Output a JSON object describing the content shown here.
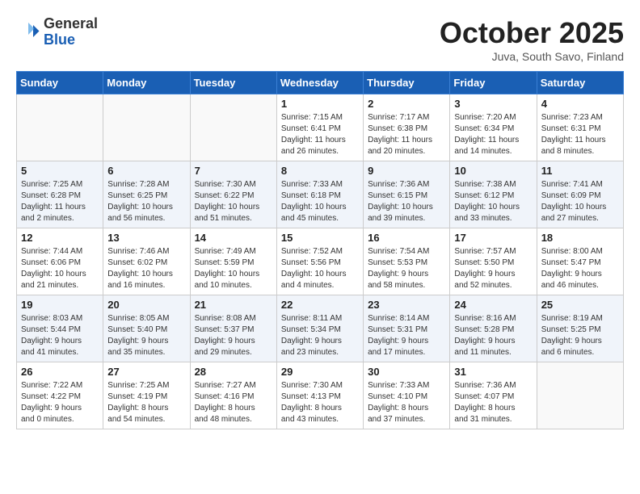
{
  "header": {
    "logo_general": "General",
    "logo_blue": "Blue",
    "month": "October 2025",
    "location": "Juva, South Savo, Finland"
  },
  "weekdays": [
    "Sunday",
    "Monday",
    "Tuesday",
    "Wednesday",
    "Thursday",
    "Friday",
    "Saturday"
  ],
  "weeks": [
    [
      {
        "day": "",
        "info": ""
      },
      {
        "day": "",
        "info": ""
      },
      {
        "day": "",
        "info": ""
      },
      {
        "day": "1",
        "info": "Sunrise: 7:15 AM\nSunset: 6:41 PM\nDaylight: 11 hours\nand 26 minutes."
      },
      {
        "day": "2",
        "info": "Sunrise: 7:17 AM\nSunset: 6:38 PM\nDaylight: 11 hours\nand 20 minutes."
      },
      {
        "day": "3",
        "info": "Sunrise: 7:20 AM\nSunset: 6:34 PM\nDaylight: 11 hours\nand 14 minutes."
      },
      {
        "day": "4",
        "info": "Sunrise: 7:23 AM\nSunset: 6:31 PM\nDaylight: 11 hours\nand 8 minutes."
      }
    ],
    [
      {
        "day": "5",
        "info": "Sunrise: 7:25 AM\nSunset: 6:28 PM\nDaylight: 11 hours\nand 2 minutes."
      },
      {
        "day": "6",
        "info": "Sunrise: 7:28 AM\nSunset: 6:25 PM\nDaylight: 10 hours\nand 56 minutes."
      },
      {
        "day": "7",
        "info": "Sunrise: 7:30 AM\nSunset: 6:22 PM\nDaylight: 10 hours\nand 51 minutes."
      },
      {
        "day": "8",
        "info": "Sunrise: 7:33 AM\nSunset: 6:18 PM\nDaylight: 10 hours\nand 45 minutes."
      },
      {
        "day": "9",
        "info": "Sunrise: 7:36 AM\nSunset: 6:15 PM\nDaylight: 10 hours\nand 39 minutes."
      },
      {
        "day": "10",
        "info": "Sunrise: 7:38 AM\nSunset: 6:12 PM\nDaylight: 10 hours\nand 33 minutes."
      },
      {
        "day": "11",
        "info": "Sunrise: 7:41 AM\nSunset: 6:09 PM\nDaylight: 10 hours\nand 27 minutes."
      }
    ],
    [
      {
        "day": "12",
        "info": "Sunrise: 7:44 AM\nSunset: 6:06 PM\nDaylight: 10 hours\nand 21 minutes."
      },
      {
        "day": "13",
        "info": "Sunrise: 7:46 AM\nSunset: 6:02 PM\nDaylight: 10 hours\nand 16 minutes."
      },
      {
        "day": "14",
        "info": "Sunrise: 7:49 AM\nSunset: 5:59 PM\nDaylight: 10 hours\nand 10 minutes."
      },
      {
        "day": "15",
        "info": "Sunrise: 7:52 AM\nSunset: 5:56 PM\nDaylight: 10 hours\nand 4 minutes."
      },
      {
        "day": "16",
        "info": "Sunrise: 7:54 AM\nSunset: 5:53 PM\nDaylight: 9 hours\nand 58 minutes."
      },
      {
        "day": "17",
        "info": "Sunrise: 7:57 AM\nSunset: 5:50 PM\nDaylight: 9 hours\nand 52 minutes."
      },
      {
        "day": "18",
        "info": "Sunrise: 8:00 AM\nSunset: 5:47 PM\nDaylight: 9 hours\nand 46 minutes."
      }
    ],
    [
      {
        "day": "19",
        "info": "Sunrise: 8:03 AM\nSunset: 5:44 PM\nDaylight: 9 hours\nand 41 minutes."
      },
      {
        "day": "20",
        "info": "Sunrise: 8:05 AM\nSunset: 5:40 PM\nDaylight: 9 hours\nand 35 minutes."
      },
      {
        "day": "21",
        "info": "Sunrise: 8:08 AM\nSunset: 5:37 PM\nDaylight: 9 hours\nand 29 minutes."
      },
      {
        "day": "22",
        "info": "Sunrise: 8:11 AM\nSunset: 5:34 PM\nDaylight: 9 hours\nand 23 minutes."
      },
      {
        "day": "23",
        "info": "Sunrise: 8:14 AM\nSunset: 5:31 PM\nDaylight: 9 hours\nand 17 minutes."
      },
      {
        "day": "24",
        "info": "Sunrise: 8:16 AM\nSunset: 5:28 PM\nDaylight: 9 hours\nand 11 minutes."
      },
      {
        "day": "25",
        "info": "Sunrise: 8:19 AM\nSunset: 5:25 PM\nDaylight: 9 hours\nand 6 minutes."
      }
    ],
    [
      {
        "day": "26",
        "info": "Sunrise: 7:22 AM\nSunset: 4:22 PM\nDaylight: 9 hours\nand 0 minutes."
      },
      {
        "day": "27",
        "info": "Sunrise: 7:25 AM\nSunset: 4:19 PM\nDaylight: 8 hours\nand 54 minutes."
      },
      {
        "day": "28",
        "info": "Sunrise: 7:27 AM\nSunset: 4:16 PM\nDaylight: 8 hours\nand 48 minutes."
      },
      {
        "day": "29",
        "info": "Sunrise: 7:30 AM\nSunset: 4:13 PM\nDaylight: 8 hours\nand 43 minutes."
      },
      {
        "day": "30",
        "info": "Sunrise: 7:33 AM\nSunset: 4:10 PM\nDaylight: 8 hours\nand 37 minutes."
      },
      {
        "day": "31",
        "info": "Sunrise: 7:36 AM\nSunset: 4:07 PM\nDaylight: 8 hours\nand 31 minutes."
      },
      {
        "day": "",
        "info": ""
      }
    ]
  ]
}
